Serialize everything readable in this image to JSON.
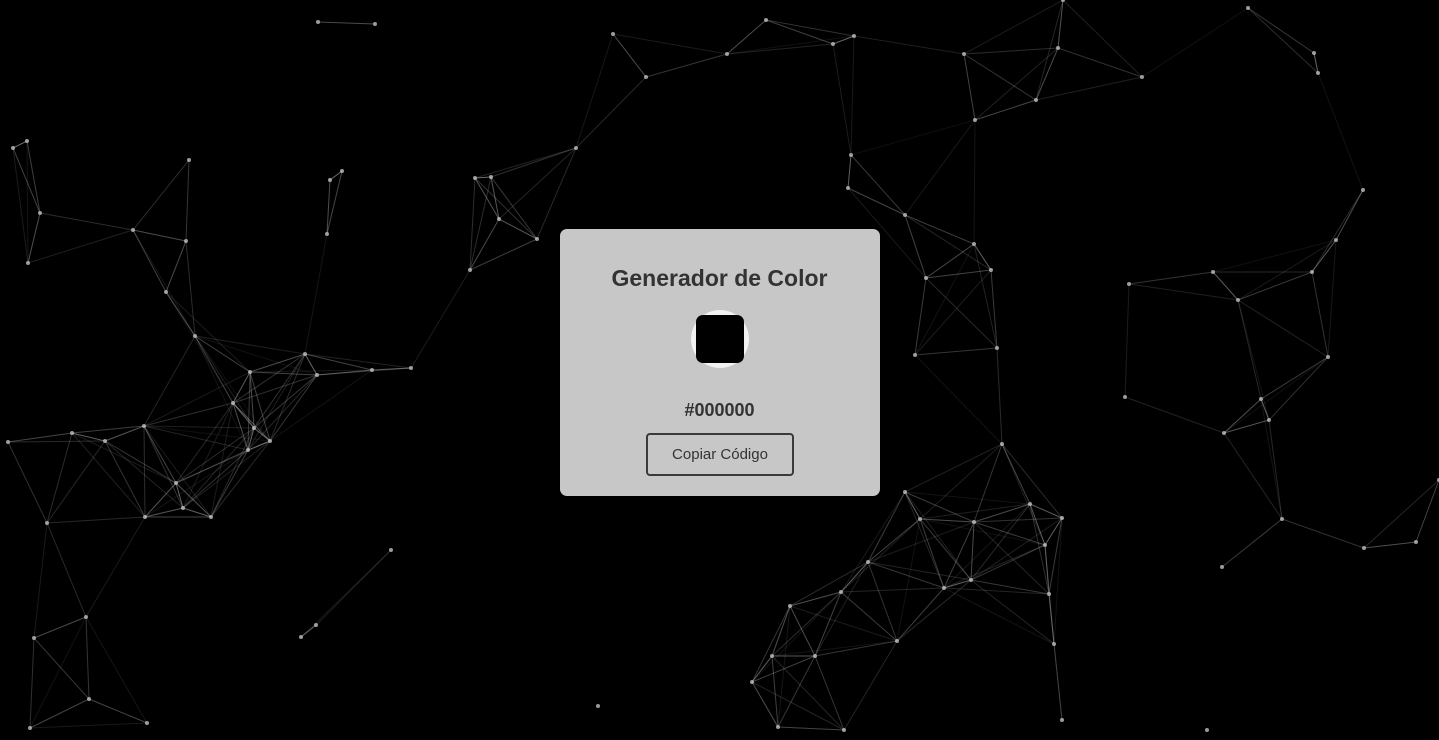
{
  "generator": {
    "title": "Generador de Color",
    "current_color": "#000000",
    "hex_label": "#000000",
    "copy_button_label": "Copiar Código"
  },
  "theme": {
    "background": "#000000",
    "card_background": "#d6d6d6",
    "text_color": "#333333",
    "particle_color": "#bfbfbf"
  }
}
